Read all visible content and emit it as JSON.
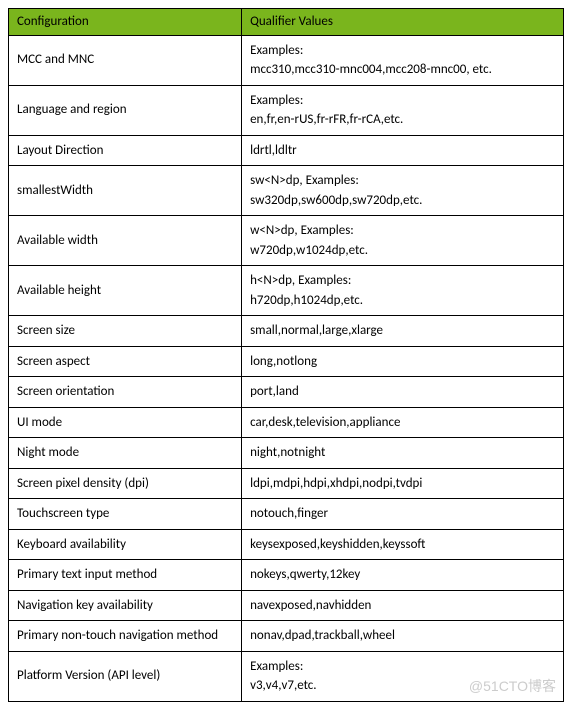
{
  "headers": {
    "config": "Configuration",
    "values": "Qualifier Values"
  },
  "rows": [
    {
      "config": "MCC and MNC",
      "values": "Examples:\nmcc310,mcc310-mnc004,mcc208-mnc00, etc."
    },
    {
      "config": "Language and region",
      "values": "Examples:\nen,fr,en-rUS,fr-rFR,fr-rCA,etc."
    },
    {
      "config": "Layout Direction",
      "values": "ldrtl,ldltr"
    },
    {
      "config": "smallestWidth",
      "values": "sw<N>dp, Examples:\nsw320dp,sw600dp,sw720dp,etc."
    },
    {
      "config": "Available width",
      "values": "w<N>dp, Examples:\nw720dp,w1024dp,etc."
    },
    {
      "config": "Available height",
      "values": "h<N>dp, Examples:\nh720dp,h1024dp,etc."
    },
    {
      "config": "Screen size",
      "values": "small,normal,large,xlarge"
    },
    {
      "config": "Screen aspect",
      "values": "long,notlong"
    },
    {
      "config": "Screen orientation",
      "values": "port,land"
    },
    {
      "config": "UI mode",
      "values": "car,desk,television,appliance"
    },
    {
      "config": "Night mode",
      "values": "night,notnight"
    },
    {
      "config": "Screen pixel density (dpi)",
      "values": "ldpi,mdpi,hdpi,xhdpi,nodpi,tvdpi"
    },
    {
      "config": "Touchscreen type",
      "values": "notouch,finger"
    },
    {
      "config": "Keyboard availability",
      "values": "keysexposed,keyshidden,keyssoft"
    },
    {
      "config": "Primary text input method",
      "values": "nokeys,qwerty,12key"
    },
    {
      "config": "Navigation key availability",
      "values": "navexposed,navhidden"
    },
    {
      "config": "Primary non-touch navigation method",
      "values": "nonav,dpad,trackball,wheel"
    },
    {
      "config": "Platform Version (API level)",
      "values": "Examples:\nv3,v4,v7,etc."
    }
  ],
  "watermark": "@51CTO博客"
}
